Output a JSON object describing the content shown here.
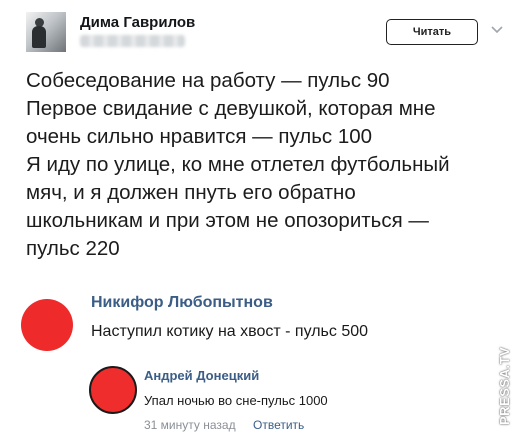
{
  "tweet": {
    "author_name": "Дима Гаврилов",
    "follow_label": "Читать",
    "lines": [
      "Собеседование на работу — пульс 90",
      "Первое свидание с девушкой, которая мне",
      "очень сильно нравится — пульс 100",
      "Я иду по улице, ко мне отлетел футбольный",
      "мяч, и я должен пнуть его обратно",
      "школьникам и при этом не опозориться —",
      "пульс 220"
    ]
  },
  "comments": {
    "first": {
      "author": "Никифор Любопытнов",
      "text": "Наступил котику на хвост - пульс 500"
    },
    "reply": {
      "author": "Андрей Донецкий",
      "text": "Упал ночью во сне-пульс 1000",
      "time": "31 минуту назад",
      "reply_label": "Ответить"
    }
  },
  "watermark": "PRESSA.TV",
  "colors": {
    "vk_link": "#3b5d86",
    "avatar_red": "#ee2a2a",
    "muted": "#8a8f96"
  },
  "icons": {
    "chevron": "chevron-down-icon"
  }
}
